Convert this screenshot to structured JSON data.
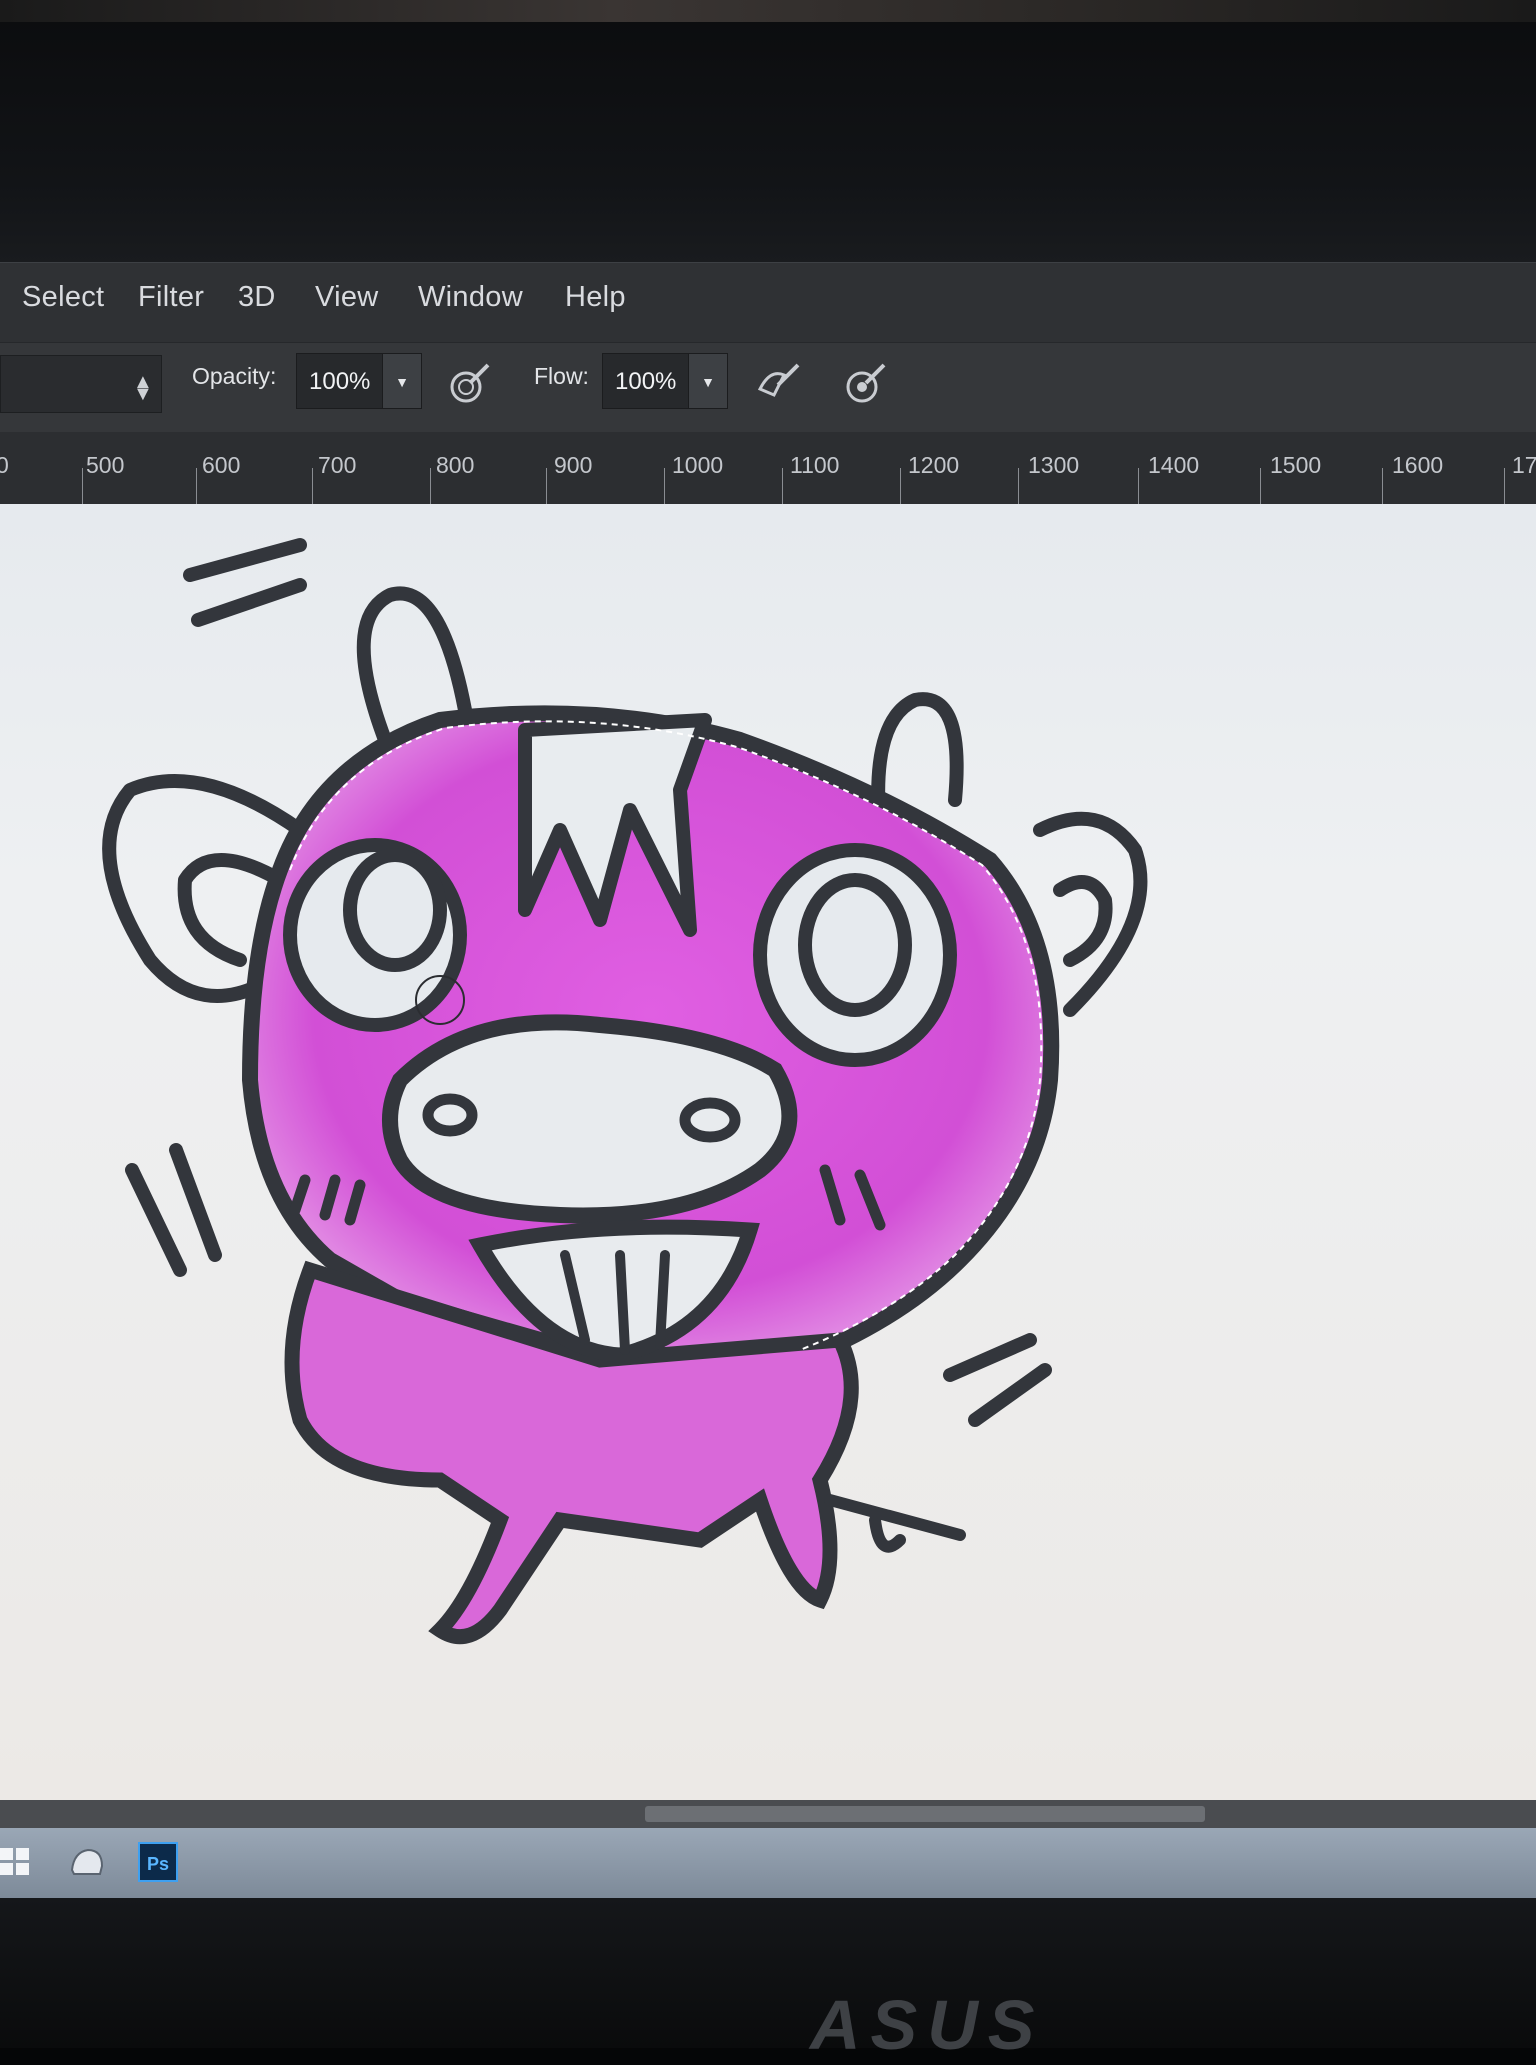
{
  "menu": {
    "items": [
      "Select",
      "Filter",
      "3D",
      "View",
      "Window",
      "Help"
    ]
  },
  "options": {
    "opacity_label": "Opacity:",
    "opacity_value": "100%",
    "flow_label": "Flow:",
    "flow_value": "100%"
  },
  "ruler": {
    "labels": [
      "0",
      "500",
      "600",
      "700",
      "800",
      "900",
      "1000",
      "1100",
      "1200",
      "1300",
      "1400",
      "1500",
      "1600",
      "17"
    ]
  },
  "taskbar": {
    "app_label": "Ps"
  },
  "monitor": {
    "brand_logo": "ASUS"
  },
  "colors": {
    "fill_magenta": "#d64fd8",
    "ink": "#2e3035",
    "ui_dark": "#2f3134"
  }
}
